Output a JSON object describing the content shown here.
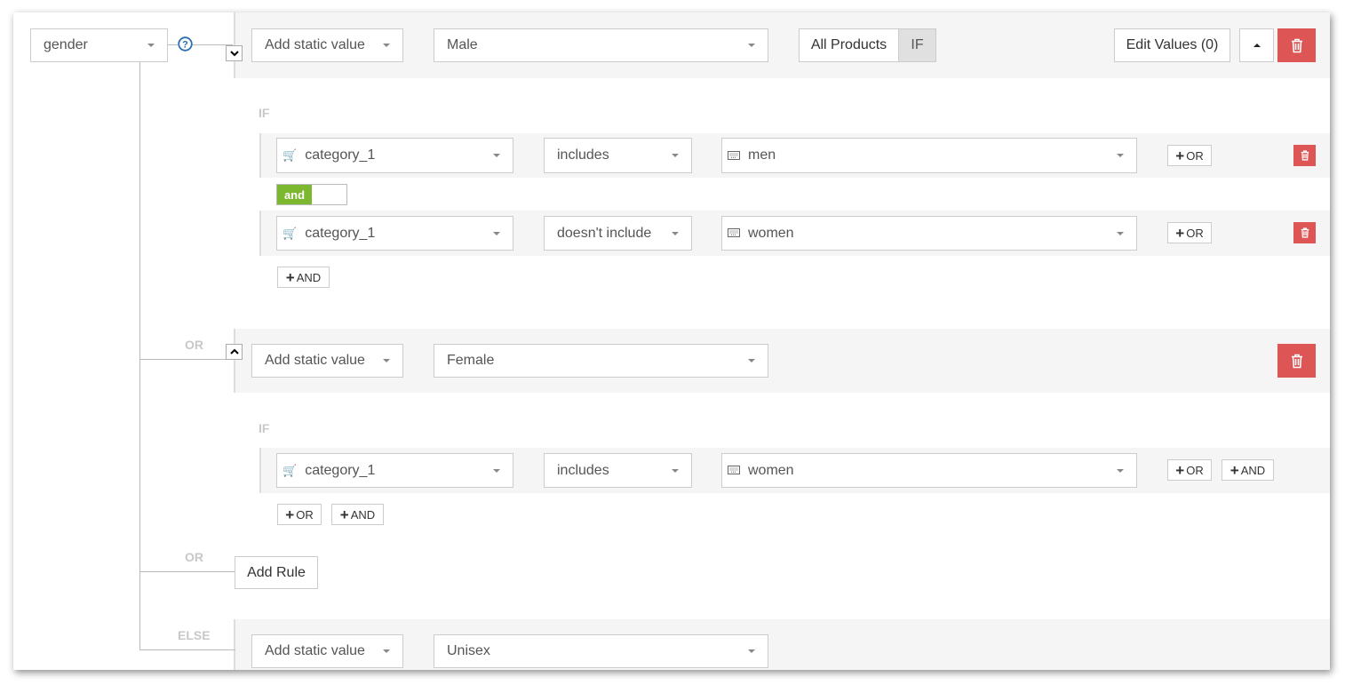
{
  "source_field": {
    "value": "gender"
  },
  "help_icon": "question-circle-icon",
  "colors": {
    "delete": "#dd5555",
    "and_badge": "#7cb82f",
    "band": "#f5f5f5"
  },
  "rule1": {
    "type_select": "Add static value",
    "value_select": "Male",
    "all_products_label": "All Products",
    "if_label": "IF",
    "edit_values_label": "Edit Values (0)",
    "condition_label": "IF",
    "conditions": [
      {
        "field": "category_1",
        "operator": "includes",
        "value": "men",
        "or_label": "OR"
      },
      {
        "field": "category_1",
        "operator": "doesn't include",
        "value": "women",
        "or_label": "OR"
      }
    ],
    "and_badge": "and",
    "add_and_label": "AND"
  },
  "rule2": {
    "connector_label": "OR",
    "type_select": "Add static value",
    "value_select": "Female",
    "condition_label": "IF",
    "conditions": [
      {
        "field": "category_1",
        "operator": "includes",
        "value": "women",
        "or_label": "OR",
        "and_label": "AND"
      }
    ],
    "add_or_label": "OR",
    "add_and_label": "AND"
  },
  "add_rule": {
    "connector_label": "OR",
    "button_label": "Add Rule"
  },
  "else_rule": {
    "connector_label": "ELSE",
    "type_select": "Add static value",
    "value_select": "Unisex"
  }
}
